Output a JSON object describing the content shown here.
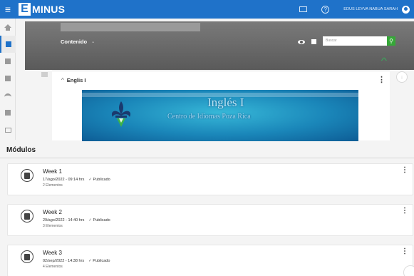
{
  "app": {
    "logo_letter": "E",
    "logo_text": "MINUS",
    "user_name": "EDUS LEYVA NABUA SARAH"
  },
  "icons": {
    "menu": "hamburger-icon",
    "mail": "mail-icon",
    "help": "help-icon",
    "user": "user-icon"
  },
  "sidebar": {
    "items": [
      {
        "icon": "home-icon"
      },
      {
        "icon": "dashboard-icon",
        "active": true
      },
      {
        "icon": "document-icon"
      },
      {
        "icon": "book-icon"
      },
      {
        "icon": "people-icon"
      },
      {
        "icon": "chat-icon"
      },
      {
        "icon": "mail-icon"
      }
    ]
  },
  "course": {
    "content_menu": "Contenido",
    "search_placeholder": "Buscar"
  },
  "module_banner": {
    "title": "Englis I",
    "banner_title": "Inglés I",
    "banner_subtitle": "Centro de Idiomas Poza Rica"
  },
  "modules_section": {
    "title": "Módulos",
    "weeks": [
      {
        "title": "Week 1",
        "date": "17/ago/2022 - 09:14 hrs",
        "status": "Publicado",
        "count": "2 Elementos"
      },
      {
        "title": "Week 2",
        "date": "29/ago/2022 - 14:40 hrs",
        "status": "Publicado",
        "count": "3 Elementos"
      },
      {
        "title": "Week 3",
        "date": "02/sep/2022 - 14:38 hrs",
        "status": "Publicado",
        "count": "4 Elementos"
      }
    ]
  },
  "colors": {
    "primary": "#1f72c9",
    "search_button": "#36a738",
    "chevron_green": "#3aa85a"
  }
}
